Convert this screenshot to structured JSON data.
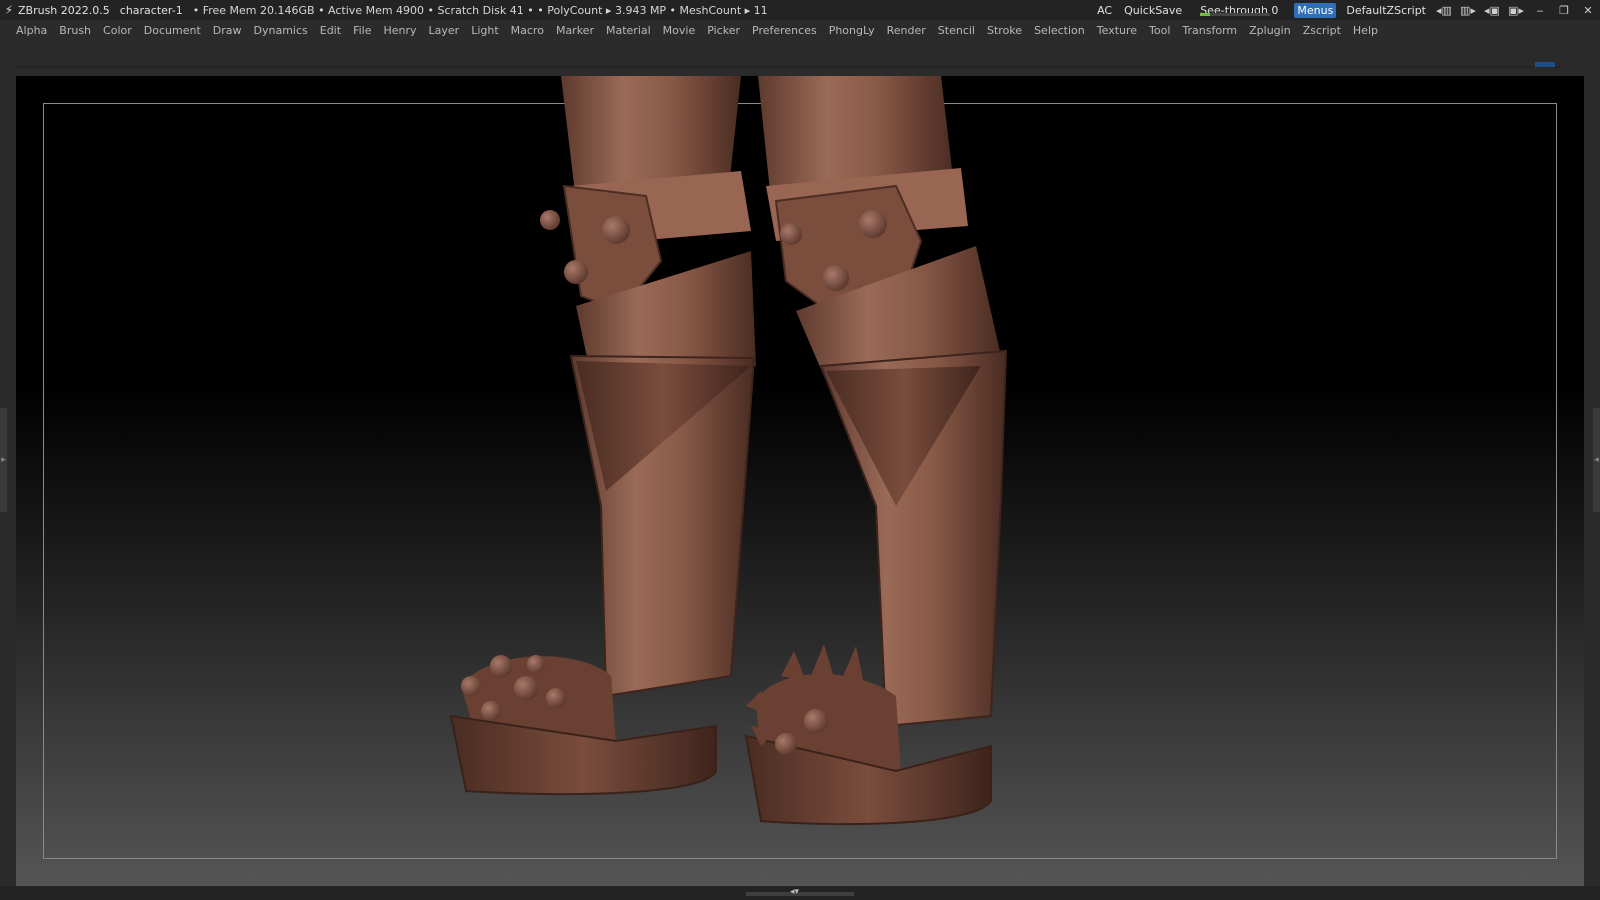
{
  "titlebar": {
    "app": "ZBrush 2022.0.5",
    "document": "character-1",
    "stats": "• Free Mem 20.146GB • Active Mem 4900 • Scratch Disk 41 •  • PolyCount ▸ 3.943 MP  • MeshCount ▸ 11",
    "ac": "AC",
    "quicksave": "QuickSave",
    "seethrough_label": "See-through",
    "seethrough_value": "0",
    "seethrough_fraction": 0.0,
    "menus": "Menus",
    "script": "DefaultZScript"
  },
  "menu": [
    "Alpha",
    "Brush",
    "Color",
    "Document",
    "Draw",
    "Dynamics",
    "Edit",
    "File",
    "Henry",
    "Layer",
    "Light",
    "Macro",
    "Marker",
    "Material",
    "Movie",
    "Picker",
    "Preferences",
    "PhongLy",
    "Render",
    "Stencil",
    "Stroke",
    "Selection",
    "Texture",
    "Tool",
    "Transform",
    "Zplugin",
    "Zscript",
    "Help"
  ],
  "colors": {
    "accent": "#2f6fb5",
    "clay": "#8a5a48",
    "seethrough_fill": "#6ec13a"
  }
}
